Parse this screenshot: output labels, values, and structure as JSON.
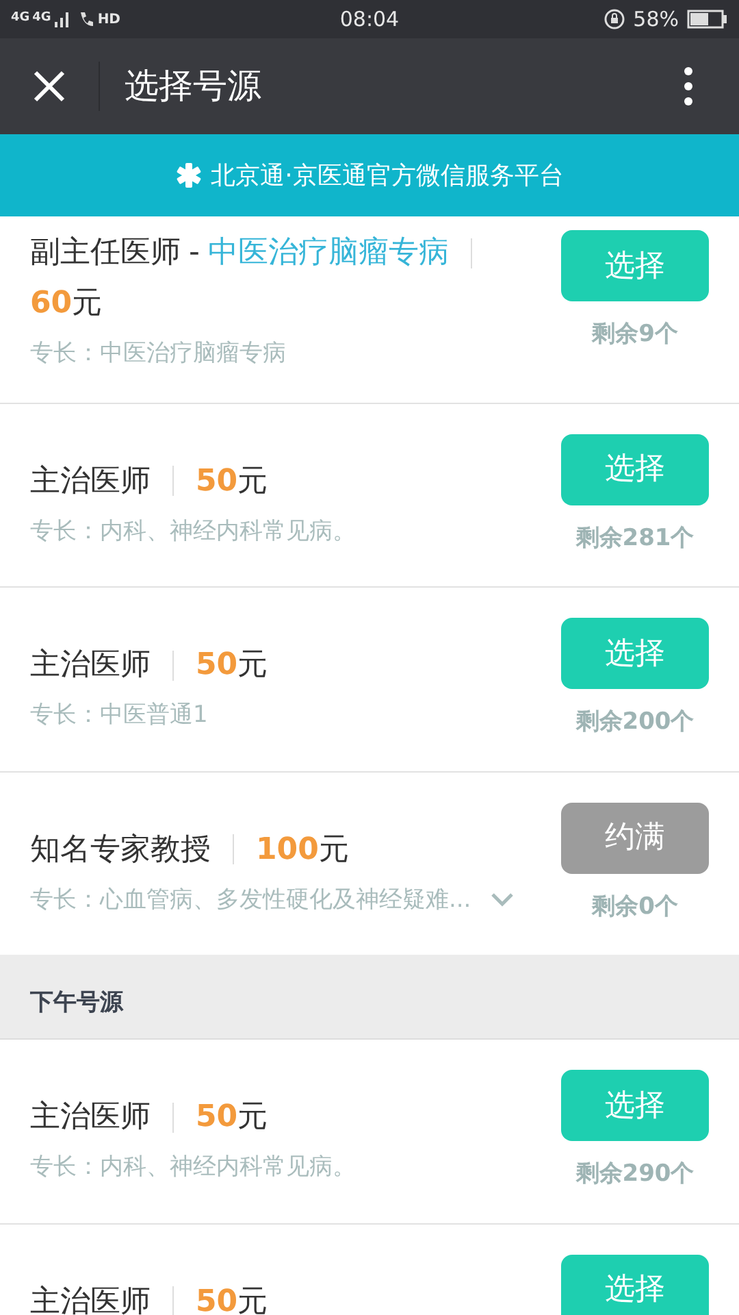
{
  "status_bar": {
    "network_labels": [
      "4G",
      "4G"
    ],
    "call_label": "HD",
    "time": "08:04",
    "battery": "58%"
  },
  "header": {
    "title": "选择号源"
  },
  "banner": {
    "text": "北京通·京医通官方微信服务平台"
  },
  "sections": [
    {
      "slots": [
        {
          "title": "副主任医师",
          "subtitle": "中医治疗脑瘤专病",
          "separator": "-",
          "amount": "60",
          "unit": "元",
          "specialty": "专长：中医治疗脑瘤专病",
          "expandable": false,
          "button": "选择",
          "disabled": false,
          "remaining": "剩余9个"
        },
        {
          "title": "主治医师",
          "amount": "50",
          "unit": "元",
          "specialty": "专长：内科、神经内科常见病。",
          "expandable": false,
          "button": "选择",
          "disabled": false,
          "remaining": "剩余281个"
        },
        {
          "title": "主治医师",
          "amount": "50",
          "unit": "元",
          "specialty": "专长：中医普通1",
          "expandable": false,
          "button": "选择",
          "disabled": false,
          "remaining": "剩余200个"
        },
        {
          "title": "知名专家教授",
          "amount": "100",
          "unit": "元",
          "specialty": "专长：心血管病、多发性硬化及神经疑难...",
          "expandable": true,
          "button": "约满",
          "disabled": true,
          "remaining": "剩余0个"
        }
      ]
    },
    {
      "heading": "下午号源",
      "slots": [
        {
          "title": "主治医师",
          "amount": "50",
          "unit": "元",
          "specialty": "专长：内科、神经内科常见病。",
          "expandable": false,
          "button": "选择",
          "disabled": false,
          "remaining": "剩余290个"
        },
        {
          "title": "主治医师",
          "amount": "50",
          "unit": "元",
          "button": "选择",
          "disabled": false
        }
      ]
    }
  ]
}
